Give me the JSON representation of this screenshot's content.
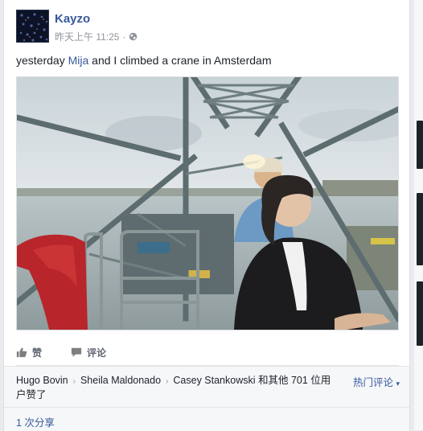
{
  "post": {
    "author": "Kayzo",
    "timestamp": "昨天上午 11:25",
    "audience_icon": "globe-icon",
    "text_before": "yesterday ",
    "mention": "Mija",
    "text_after": " and I climbed a crane in Amsterdam"
  },
  "photo": {
    "description_icon": "photo"
  },
  "actions": {
    "like": "赞",
    "comment": "评论"
  },
  "reactions": {
    "names": [
      "Hugo Bovin",
      "Sheila Maldonado",
      "Casey Stankowski"
    ],
    "others_text": "和其他 701 位用户赞了",
    "sort_label": "热门评论"
  },
  "shares": {
    "text": "1 次分享"
  },
  "colors": {
    "link": "#365899",
    "text": "#1d2129",
    "muted": "#90949c",
    "background": "#e9ebee"
  }
}
